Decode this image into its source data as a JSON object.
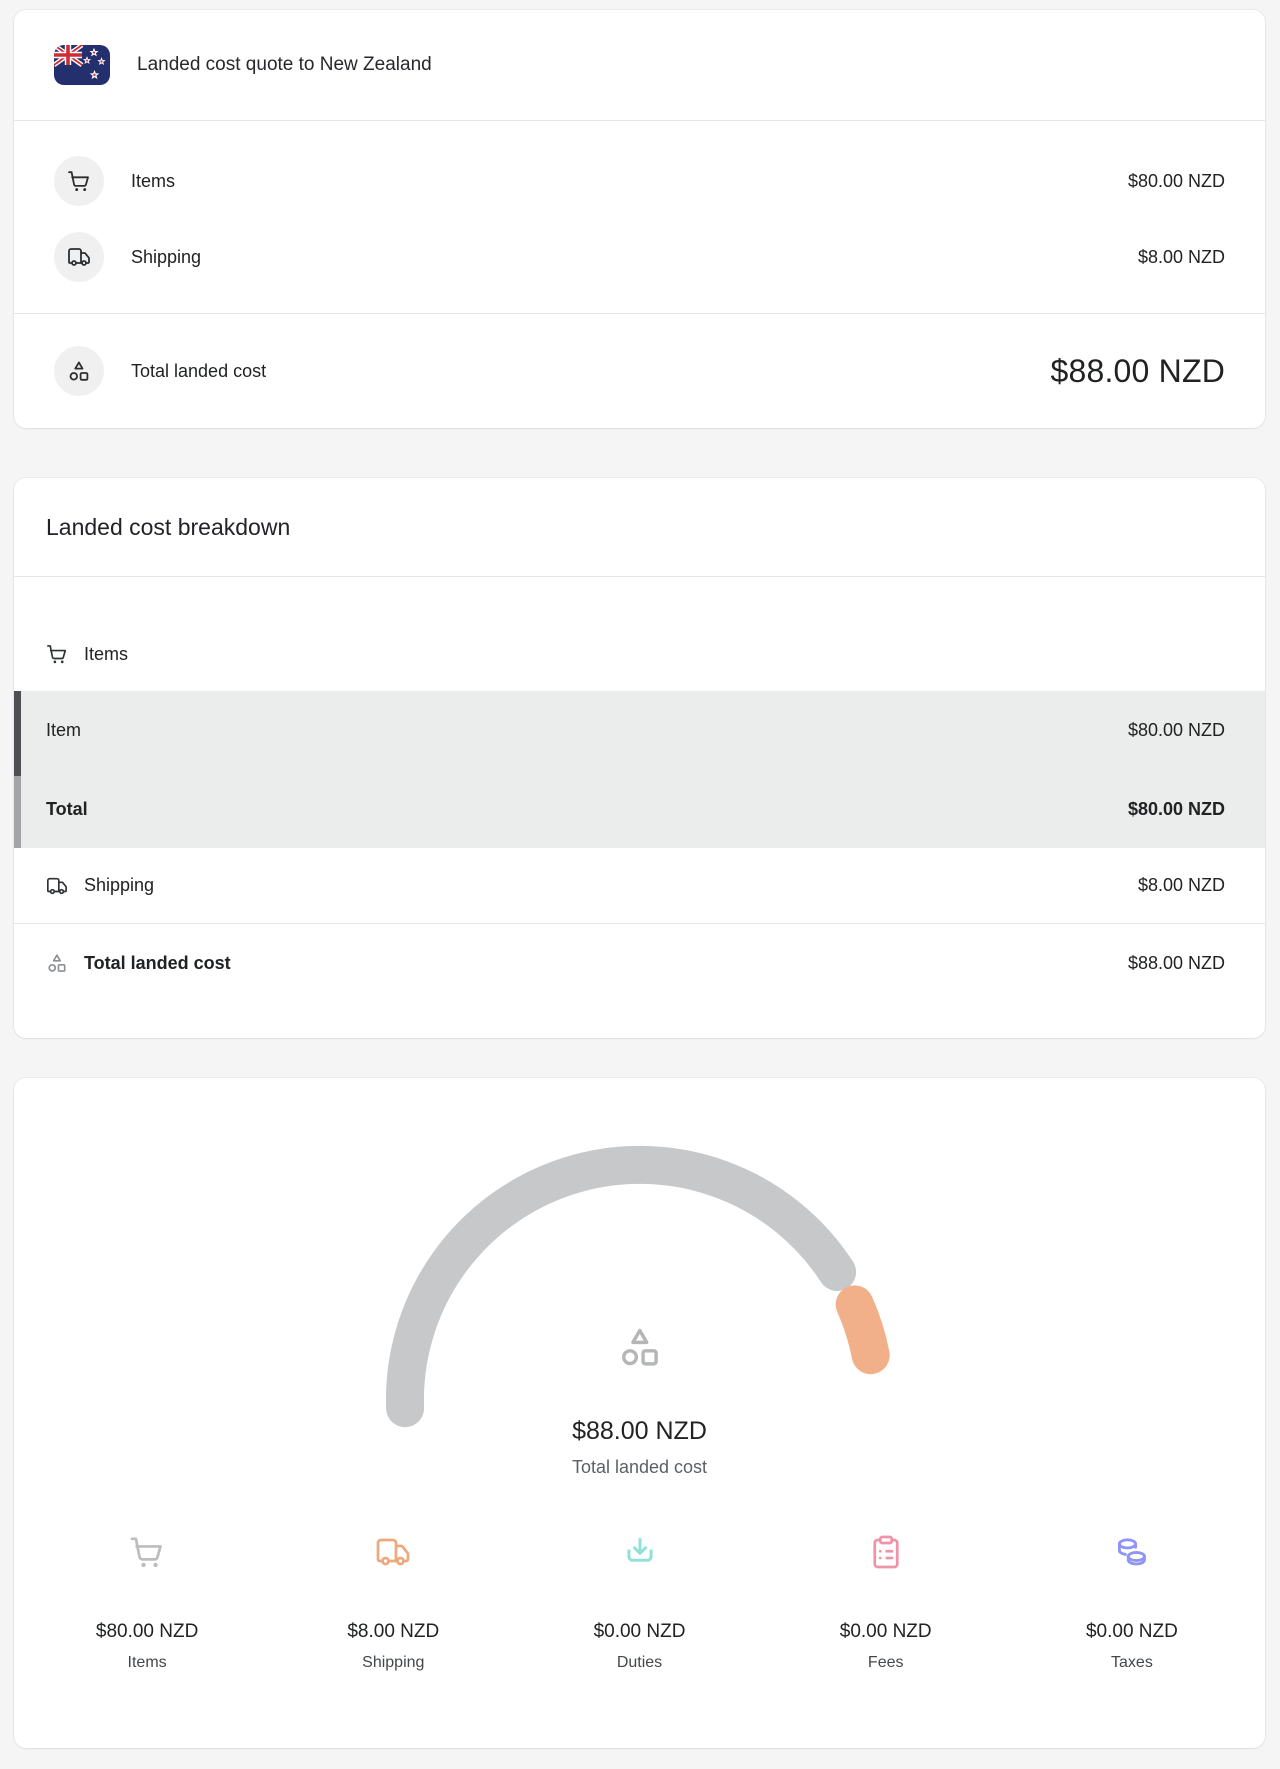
{
  "colors": {
    "page_background": "#f5f5f6",
    "card_background": "#ffffff",
    "text_primary": "#202223",
    "text_secondary": "#5d6165",
    "divider": "#e6e7e8",
    "highlight_row_background": "#ebecec",
    "scrollbar_thumb": "#4c4f53",
    "scrollbar_track": "#a2a5a8",
    "gauge_gray": "#c7c8ca",
    "gauge_orange": "#f2b08a",
    "items_icon": "#bcbdbf",
    "shipping_icon": "#eda87d",
    "duties_icon": "#90e2d9",
    "fees_icon": "#f193a8",
    "taxes_icon": "#8e95f6",
    "flag_navy": "#24306e",
    "flag_red": "#cf2b36"
  },
  "quote_card": {
    "title": "Landed cost quote to New Zealand",
    "flag": "new-zealand-flag",
    "items_label": "Items",
    "items_value": "$80.00 NZD",
    "shipping_label": "Shipping",
    "shipping_value": "$8.00 NZD",
    "total_label": "Total landed cost",
    "total_value": "$88.00 NZD"
  },
  "breakdown_card": {
    "heading": "Landed cost breakdown",
    "items_header": "Items",
    "item_row": {
      "label": "Item",
      "value": "$80.00 NZD"
    },
    "items_total_row": {
      "label": "Total",
      "value": "$80.00 NZD"
    },
    "shipping_row": {
      "label": "Shipping",
      "value": "$8.00 NZD"
    },
    "total_row": {
      "label": "Total landed cost",
      "value": "$88.00 NZD"
    }
  },
  "gauge_card": {
    "center_value": "$88.00 NZD",
    "center_label": "Total landed cost",
    "stats": [
      {
        "label": "Items",
        "value": "$80.00 NZD",
        "icon": "cart-icon"
      },
      {
        "label": "Shipping",
        "value": "$8.00 NZD",
        "icon": "truck-icon"
      },
      {
        "label": "Duties",
        "value": "$0.00 NZD",
        "icon": "tray-download-icon"
      },
      {
        "label": "Fees",
        "value": "$0.00 NZD",
        "icon": "clipboard-list-icon"
      },
      {
        "label": "Taxes",
        "value": "$0.00 NZD",
        "icon": "coins-icon"
      }
    ]
  },
  "chart_data": {
    "type": "gauge",
    "title": "Total landed cost",
    "center_value": "$88.00 NZD",
    "currency": "NZD",
    "total": 88.0,
    "series": [
      {
        "name": "Items",
        "value": 80.0,
        "color": "#c7c8ca"
      },
      {
        "name": "Shipping",
        "value": 8.0,
        "color": "#f2b08a"
      },
      {
        "name": "Duties",
        "value": 0.0
      },
      {
        "name": "Fees",
        "value": 0.0
      },
      {
        "name": "Taxes",
        "value": 0.0
      }
    ],
    "layout": {
      "shape": "semicircle-arc",
      "segment_gap_degrees": 6,
      "rounded_caps": true
    }
  }
}
